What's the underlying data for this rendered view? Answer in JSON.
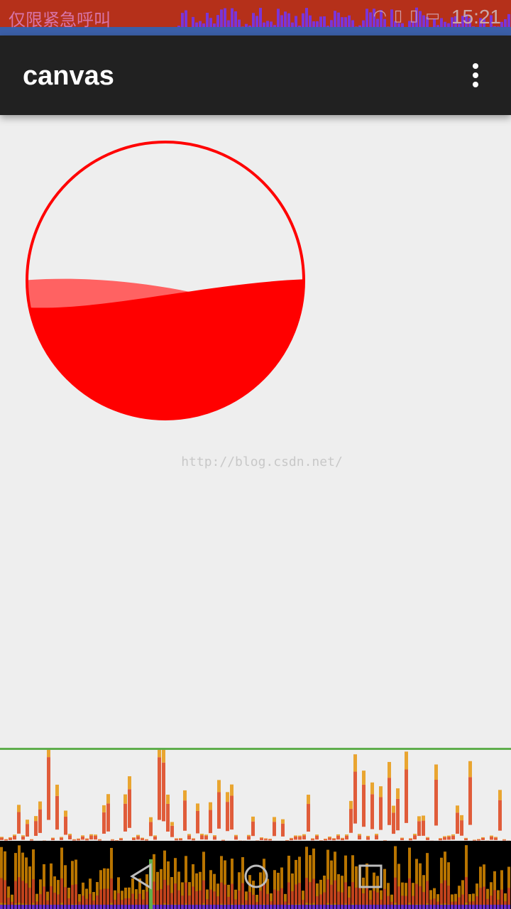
{
  "status_bar": {
    "carrier": "仅限紧急呼叫",
    "time": "15:21",
    "icons": [
      "wifi-icon",
      "sim-icon",
      "sim-icon",
      "battery-icon"
    ]
  },
  "app_bar": {
    "title": "canvas",
    "overflow_icon": "overflow-menu-icon"
  },
  "wave": {
    "color": "#ff0000",
    "light_color": "#ff6262",
    "fill_level": 0.5
  },
  "watermark": "http://blog.csdn.net/",
  "nav_bar": {
    "buttons": [
      "back-icon",
      "home-icon",
      "recents-icon"
    ]
  },
  "colors": {
    "toolbar": "#212121",
    "background": "#eeeeee",
    "accent_line": "#5fae4d",
    "status_bar": "#b5301a"
  }
}
